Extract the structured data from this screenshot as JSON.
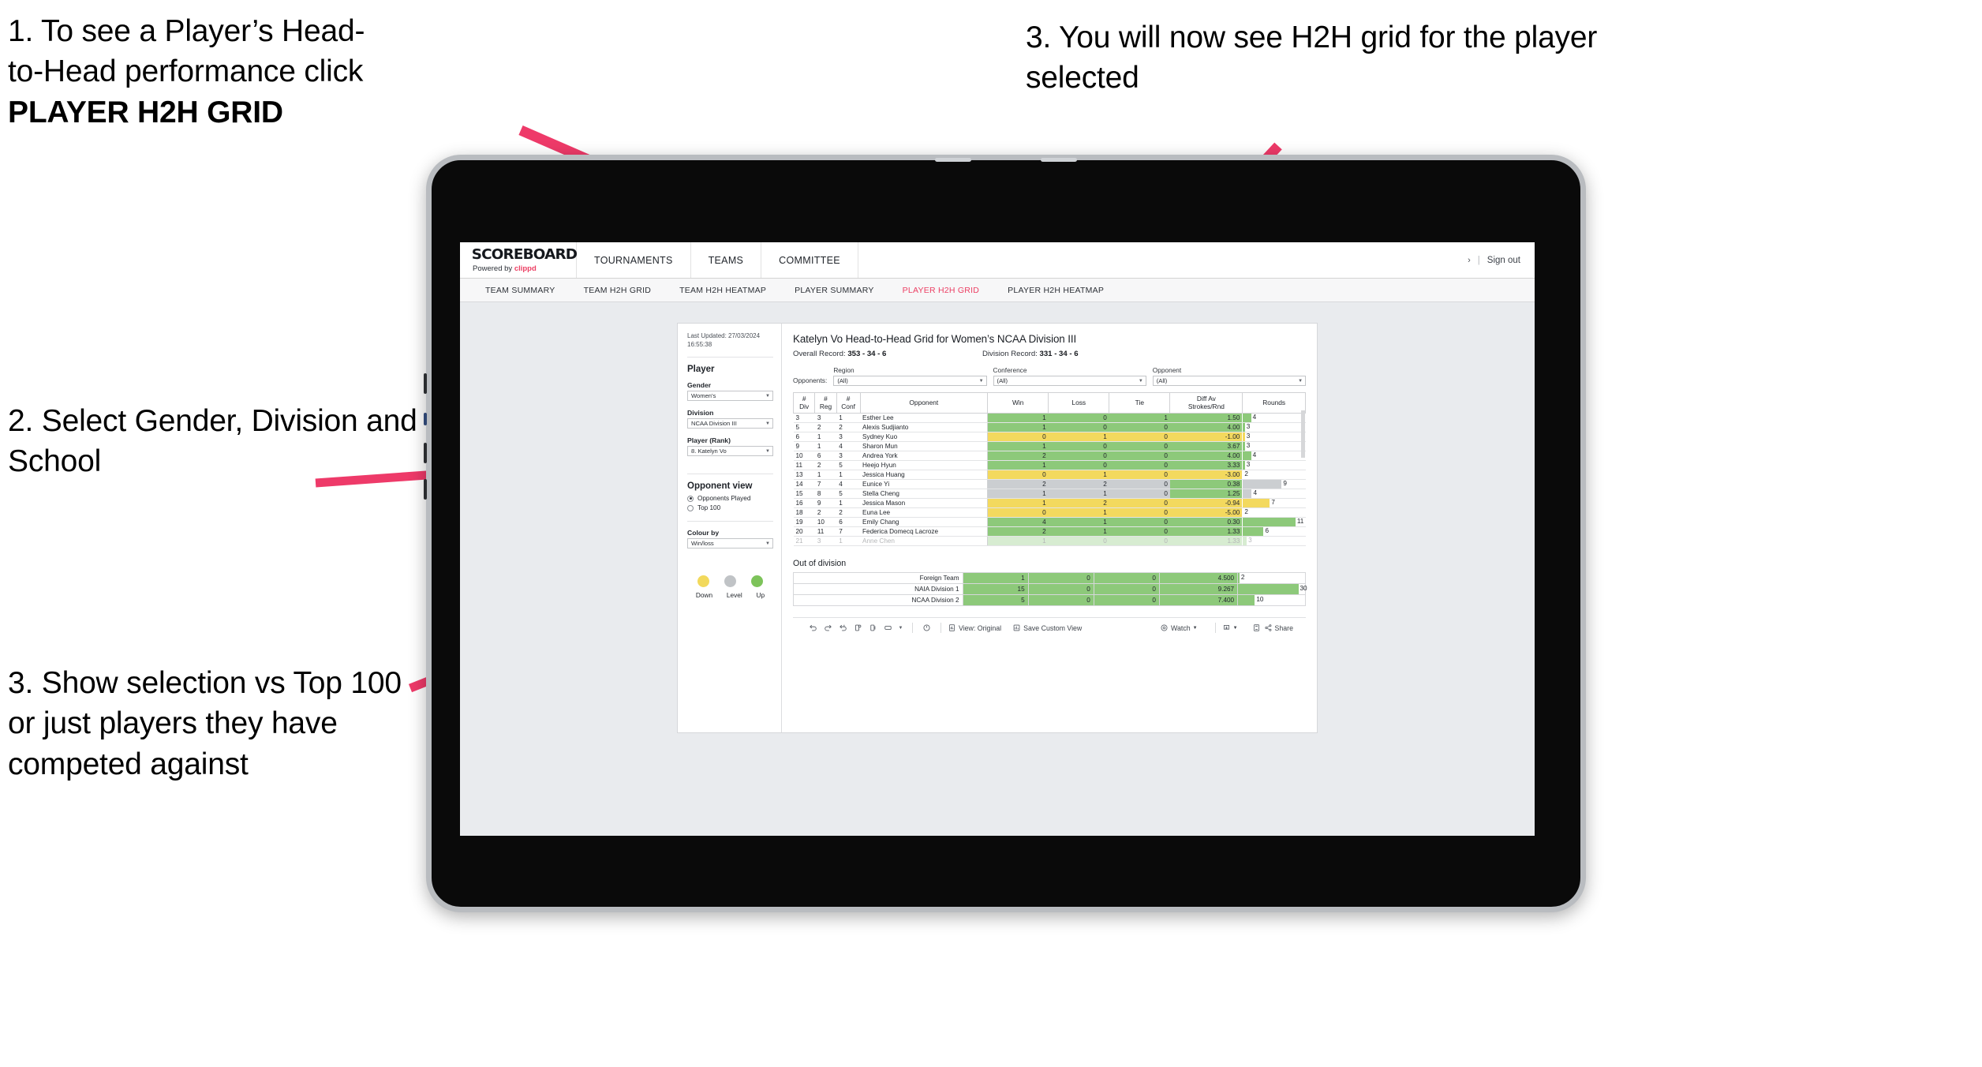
{
  "annotations": {
    "step1_line1": "1. To see a Player’s Head-",
    "step1_line2": "to-Head performance click",
    "step1_bold": "PLAYER H2H GRID",
    "step2": "2. Select Gender, Division and School",
    "step3_left": "3. Show selection vs Top 100 or just players they have competed against",
    "step3_right": "3. You will now see H2H grid for the player selected",
    "accent_color": "#ee3a69"
  },
  "app": {
    "brand": {
      "logo": "SCOREBOARD",
      "powered_prefix": "Powered by ",
      "powered_name": "clippd"
    },
    "header_nav": [
      "TOURNAMENTS",
      "TEAMS",
      "COMMITTEE"
    ],
    "header_right": {
      "chevron": "›",
      "separator": "|",
      "signout": "Sign out"
    },
    "tabs": [
      {
        "label": "TEAM SUMMARY",
        "active": false
      },
      {
        "label": "TEAM H2H GRID",
        "active": false
      },
      {
        "label": "TEAM H2H HEATMAP",
        "active": false
      },
      {
        "label": "PLAYER SUMMARY",
        "active": false
      },
      {
        "label": "PLAYER H2H GRID",
        "active": true
      },
      {
        "label": "PLAYER H2H HEATMAP",
        "active": false
      }
    ],
    "accent": "#ec3f63"
  },
  "panel": {
    "last_updated_line1": "Last Updated: 27/03/2024",
    "last_updated_line2": "16:55:38",
    "player_section_title": "Player",
    "filters": [
      {
        "label": "Gender",
        "value": "Women's"
      },
      {
        "label": "Division",
        "value": "NCAA Division III"
      },
      {
        "label": "Player (Rank)",
        "value": "8. Katelyn Vo"
      }
    ],
    "opponent_view_title": "Opponent view",
    "opponent_view_options": [
      {
        "label": "Opponents Played",
        "selected": true
      },
      {
        "label": "Top 100",
        "selected": false
      }
    ],
    "colour_by_label": "Colour by",
    "colour_by_value": "Win/loss",
    "legend": [
      {
        "label": "Down",
        "color": "#f2d95c"
      },
      {
        "label": "Level",
        "color": "#c0c3c6"
      },
      {
        "label": "Up",
        "color": "#7dc35a"
      }
    ]
  },
  "view": {
    "title": "Katelyn Vo Head-to-Head Grid for Women’s NCAA Division III",
    "overall_record_label": "Overall Record: ",
    "overall_record_value": "353 -  34 - 6",
    "division_record_label": "Division Record: ",
    "division_record_value": "331 -  34 - 6",
    "opponents_label": "Opponents:",
    "opponent_filters": [
      {
        "label": "Region",
        "value": "(All)"
      },
      {
        "label": "Conference",
        "value": "(All)"
      },
      {
        "label": "Opponent",
        "value": "(All)"
      }
    ],
    "out_of_division_title": "Out of division"
  },
  "chart_data": {
    "type": "table",
    "title": "Katelyn Vo Head-to-Head Grid for Women’s NCAA Division III",
    "columns": [
      "# Div",
      "# Reg",
      "# Conf",
      "Opponent",
      "Win",
      "Loss",
      "Tie",
      "Diff Av Strokes/Rnd",
      "Rounds"
    ],
    "column_headers_multiline": [
      [
        "#",
        "Div"
      ],
      [
        "#",
        "Reg"
      ],
      [
        "#",
        "Conf"
      ],
      [
        "Opponent"
      ],
      [
        "Win"
      ],
      [
        "Loss"
      ],
      [
        "Tie"
      ],
      [
        "Diff Av",
        "Strokes/Rnd"
      ],
      [
        "Rounds"
      ]
    ],
    "colors": {
      "up": "#8dc97a",
      "down": "#f3d95e",
      "level": "#cbced1",
      "rounds_bar_up": "#8dc97a",
      "rounds_bar_down": "#f3d95e",
      "rounds_bar_level": "#cbced1"
    },
    "rows": [
      {
        "div": "3",
        "reg": "3",
        "conf": "1",
        "opponent": "Esther Lee",
        "win": "1",
        "loss": "0",
        "tie": "1",
        "diff": "1.50",
        "rounds": "4",
        "state": "up",
        "bar_pct": 13
      },
      {
        "div": "5",
        "reg": "2",
        "conf": "2",
        "opponent": "Alexis Sudjianto",
        "win": "1",
        "loss": "0",
        "tie": "0",
        "diff": "4.00",
        "rounds": "3",
        "state": "up",
        "bar_pct": 3
      },
      {
        "div": "6",
        "reg": "1",
        "conf": "3",
        "opponent": "Sydney Kuo",
        "win": "0",
        "loss": "1",
        "tie": "0",
        "diff": "-1.00",
        "rounds": "3",
        "state": "down",
        "bar_pct": 3
      },
      {
        "div": "9",
        "reg": "1",
        "conf": "4",
        "opponent": "Sharon Mun",
        "win": "1",
        "loss": "0",
        "tie": "0",
        "diff": "3.67",
        "rounds": "3",
        "state": "up",
        "bar_pct": 3
      },
      {
        "div": "10",
        "reg": "6",
        "conf": "3",
        "opponent": "Andrea York",
        "win": "2",
        "loss": "0",
        "tie": "0",
        "diff": "4.00",
        "rounds": "4",
        "state": "up",
        "bar_pct": 13
      },
      {
        "div": "11",
        "reg": "2",
        "conf": "5",
        "opponent": "Heejo Hyun",
        "win": "1",
        "loss": "0",
        "tie": "0",
        "diff": "3.33",
        "rounds": "3",
        "state": "up",
        "bar_pct": 3
      },
      {
        "div": "13",
        "reg": "1",
        "conf": "1",
        "opponent": "Jessica Huang",
        "win": "0",
        "loss": "1",
        "tie": "0",
        "diff": "-3.00",
        "rounds": "2",
        "state": "down",
        "bar_pct": 0
      },
      {
        "div": "14",
        "reg": "7",
        "conf": "4",
        "opponent": "Eunice Yi",
        "win": "2",
        "loss": "2",
        "tie": "0",
        "diff": "0.38",
        "rounds": "9",
        "state": "level",
        "bar_pct": 62,
        "diff_state": "up"
      },
      {
        "div": "15",
        "reg": "8",
        "conf": "5",
        "opponent": "Stella Cheng",
        "win": "1",
        "loss": "1",
        "tie": "0",
        "diff": "1.25",
        "rounds": "4",
        "state": "level",
        "bar_pct": 14,
        "diff_state": "up"
      },
      {
        "div": "16",
        "reg": "9",
        "conf": "1",
        "opponent": "Jessica Mason",
        "win": "1",
        "loss": "2",
        "tie": "0",
        "diff": "-0.94",
        "rounds": "7",
        "state": "down",
        "bar_pct": 43
      },
      {
        "div": "18",
        "reg": "2",
        "conf": "2",
        "opponent": "Euna Lee",
        "win": "0",
        "loss": "1",
        "tie": "0",
        "diff": "-5.00",
        "rounds": "2",
        "state": "down",
        "bar_pct": 0
      },
      {
        "div": "19",
        "reg": "10",
        "conf": "6",
        "opponent": "Emily Chang",
        "win": "4",
        "loss": "1",
        "tie": "0",
        "diff": "0.30",
        "rounds": "11",
        "state": "up",
        "bar_pct": 84
      },
      {
        "div": "20",
        "reg": "11",
        "conf": "7",
        "opponent": "Federica Domecq Lacroze",
        "win": "2",
        "loss": "1",
        "tie": "0",
        "diff": "1.33",
        "rounds": "6",
        "state": "up",
        "bar_pct": 33
      }
    ],
    "out_of_division": {
      "title": "Out of division",
      "rows": [
        {
          "opponent": "Foreign Team",
          "win": "1",
          "loss": "0",
          "tie": "0",
          "diff": "4.500",
          "rounds": "2",
          "state": "up",
          "bar_pct": 2
        },
        {
          "opponent": "NAIA Division 1",
          "win": "15",
          "loss": "0",
          "tie": "0",
          "diff": "9.267",
          "rounds": "30",
          "state": "up",
          "bar_pct": 90
        },
        {
          "opponent": "NCAA Division 2",
          "win": "5",
          "loss": "0",
          "tie": "0",
          "diff": "7.400",
          "rounds": "10",
          "state": "up",
          "bar_pct": 25
        }
      ]
    }
  },
  "toolbar": {
    "view_label": "View: Original",
    "save_custom_view": "Save Custom View",
    "watch": "Watch",
    "share": "Share",
    "icons": [
      "undo-icon",
      "redo-icon",
      "revert-icon",
      "refresh-data-icon",
      "pause-updates-icon",
      "device-layout-icon",
      "dropdown-caret-icon",
      "alerts-icon",
      "view-original-icon",
      "save-custom-view-icon",
      "watch-icon",
      "download-icon",
      "fullscreen-icon",
      "share-icon"
    ]
  }
}
